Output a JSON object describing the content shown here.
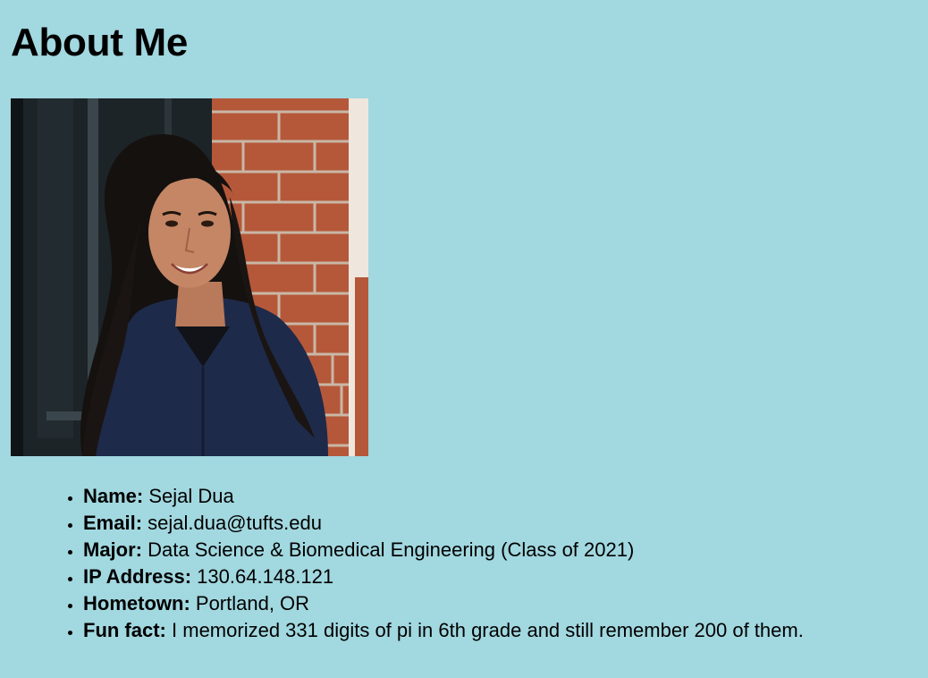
{
  "page": {
    "title": "About Me",
    "background_color": "#a2d8e0"
  },
  "photo": {
    "alt": "Photo of Sejal Dua"
  },
  "facts": [
    {
      "label": "Name:",
      "value": "Sejal Dua"
    },
    {
      "label": "Email:",
      "value": "sejal.dua@tufts.edu"
    },
    {
      "label": "Major:",
      "value": "Data Science & Biomedical Engineering (Class of 2021)"
    },
    {
      "label": "IP Address:",
      "value": "130.64.148.121"
    },
    {
      "label": "Hometown:",
      "value": "Portland, OR"
    },
    {
      "label": "Fun fact:",
      "value": "I memorized 331 digits of pi in 6th grade and still remember 200 of them."
    }
  ]
}
